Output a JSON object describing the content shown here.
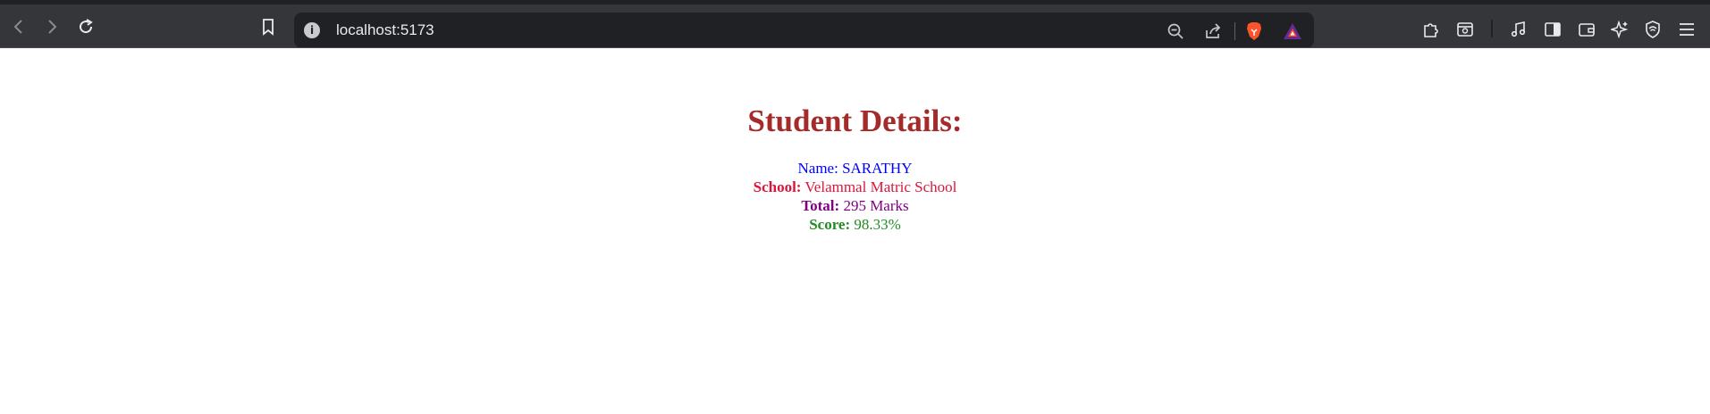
{
  "browser": {
    "url": "localhost:5173",
    "info_icon": "i"
  },
  "page": {
    "title": "Student Details:",
    "name": {
      "label": "Name:",
      "value": "SARATHY",
      "color": "#0000ff"
    },
    "school": {
      "label": "School:",
      "value": "Velammal Matric School",
      "color": "#dc143c"
    },
    "total": {
      "label": "Total:",
      "value": "295 Marks",
      "color": "#800080"
    },
    "score": {
      "label": "Score:",
      "value": "98.33%",
      "color": "#228b22"
    }
  },
  "colors": {
    "title": "#a52a2a",
    "chrome": "#35363a",
    "urlbar": "#202124"
  }
}
